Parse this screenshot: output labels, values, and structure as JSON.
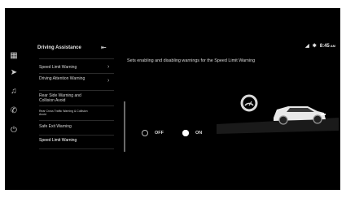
{
  "panel": {
    "title": "Driving Assistance",
    "pin_icon": "pin-icon"
  },
  "menu": [
    {
      "label": "Speed Limit Warning",
      "has_chevron": true
    },
    {
      "label": "Driving Attention Warning",
      "has_chevron": true
    },
    {
      "label": "Rear Side Warning and Collision Avoid",
      "has_chevron": false
    },
    {
      "label": "Rear Cross Traffic Warning & Collision Avoid",
      "has_chevron": false
    },
    {
      "label": "Safe Exit Warning",
      "has_chevron": false
    },
    {
      "label": "Speed Limit Warning",
      "has_chevron": false
    }
  ],
  "status": {
    "time": "8:45",
    "ampm": "AM",
    "icons": [
      "signal-icon",
      "bluetooth-icon"
    ]
  },
  "content": {
    "description": "Sets enabling and disabling warnings for the Speed Limit Warning",
    "options": [
      {
        "label": "OFF",
        "selected": false
      },
      {
        "label": "ON",
        "selected": true
      }
    ]
  },
  "rail_icons": [
    "grid-icon",
    "navigation-icon",
    "music-icon",
    "phone-icon",
    "power-icon"
  ]
}
